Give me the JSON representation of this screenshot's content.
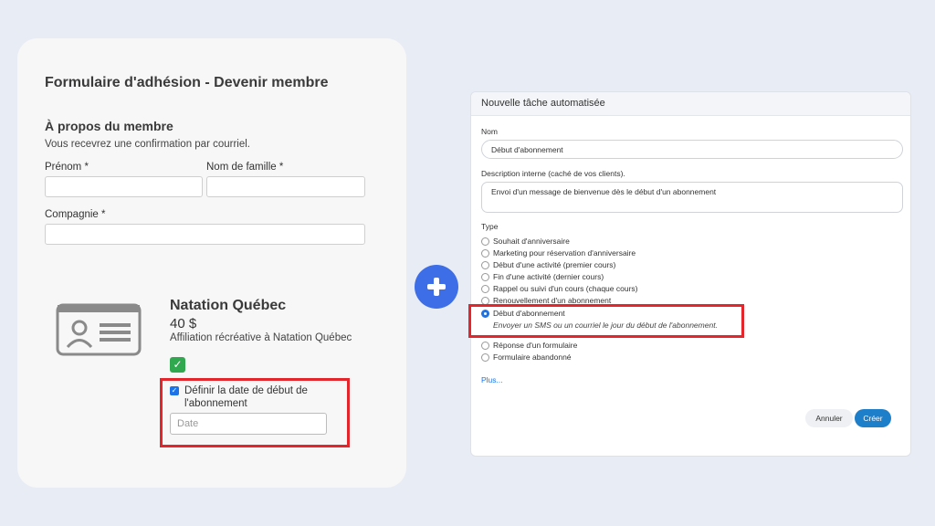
{
  "membership_form": {
    "title": "Formulaire d'adhésion - Devenir membre",
    "section_title": "À propos du membre",
    "section_subtitle": "Vous recevrez une confirmation par courriel.",
    "fields": {
      "first_name_label": "Prénom *",
      "last_name_label": "Nom de famille *",
      "company_label": "Compagnie *"
    },
    "product": {
      "icon": "id-card-icon",
      "name": "Natation Québec",
      "price": "40 $",
      "description": "Affiliation récréative à Natation Québec",
      "selected_icon": "check-icon"
    },
    "start_date": {
      "checkbox_label": "Définir la date de début de l'abonnement",
      "checked": true,
      "date_placeholder": "Date"
    }
  },
  "plus_icon": "plus-icon",
  "dialog": {
    "title": "Nouvelle tâche automatisée",
    "name_label": "Nom",
    "name_value": "Début d'abonnement",
    "description_label": "Description interne (caché de vos clients).",
    "description_value": "Envoi d'un message de bienvenue dès le début d'un abonnement",
    "type_label": "Type",
    "types": [
      "Souhait d'anniversaire",
      "Marketing pour réservation d'anniversaire",
      "Début d'une activité (premier cours)",
      "Fin d'une activité (dernier cours)",
      "Rappel ou suivi d'un cours (chaque cours)",
      "Renouvellement d'un abonnement",
      "Début d'abonnement",
      "Réponse d'un formulaire",
      "Formulaire abandonné"
    ],
    "selected_type": "Début d'abonnement",
    "selected_hint": "Envoyer un SMS ou un courriel le jour du début de l'abonnement.",
    "more_link": "Plus...",
    "cancel_label": "Annuler",
    "create_label": "Créer"
  },
  "colors": {
    "background": "#e7ecf5",
    "highlight_red": "#e3262c",
    "accent_blue": "#3d6ee8",
    "success_green": "#2fa84f"
  }
}
